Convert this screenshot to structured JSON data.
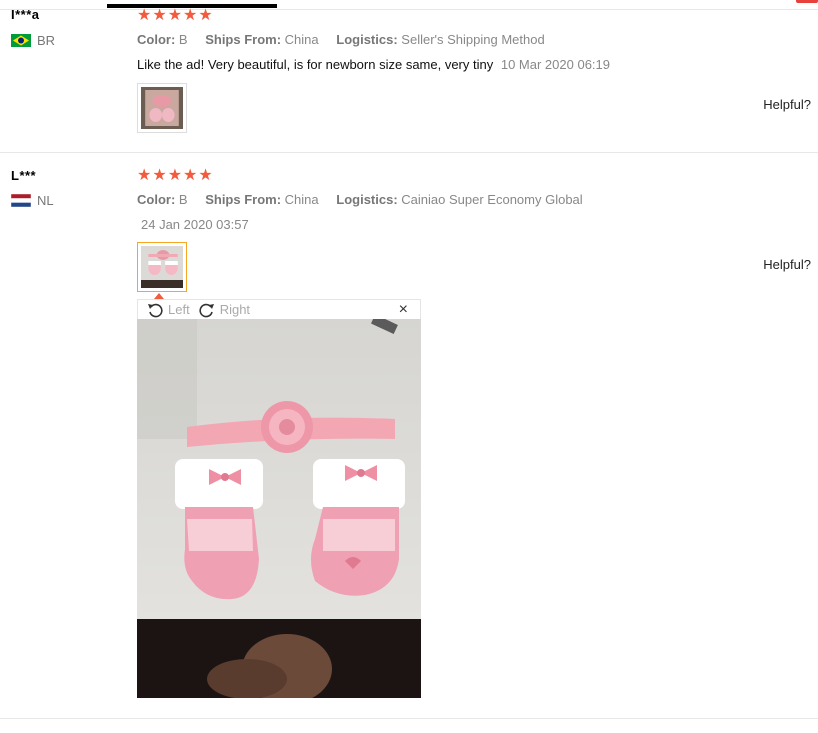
{
  "reviews": [
    {
      "user": "I***a",
      "country": "BR",
      "stars": 5,
      "color_label": "Color:",
      "color_value": "B",
      "ships_label": "Ships From:",
      "ships_value": "China",
      "logistics_label": "Logistics:",
      "logistics_value": "Seller's Shipping Method",
      "content": "Like the ad! Very beautiful, is for newborn size same, very tiny",
      "date": "10 Mar 2020 06:19",
      "helpful": "Helpful?"
    },
    {
      "user": "L***",
      "country": "NL",
      "stars": 5,
      "color_label": "Color:",
      "color_value": "B",
      "ships_label": "Ships From:",
      "ships_value": "China",
      "logistics_label": "Logistics:",
      "logistics_value": "Cainiao Super Economy Global",
      "content": "",
      "date": "24 Jan 2020 03:57",
      "helpful": "Helpful?"
    }
  ],
  "viewer": {
    "rotate_left": "Left",
    "rotate_right": "Right",
    "close": "×"
  },
  "icons": {
    "star": "star-icon",
    "rotate_left": "rotate-left-icon",
    "rotate_right": "rotate-right-icon",
    "close": "close-icon"
  },
  "colors": {
    "star": "#f25c3e",
    "active_thumb_border": "#f5a623"
  }
}
